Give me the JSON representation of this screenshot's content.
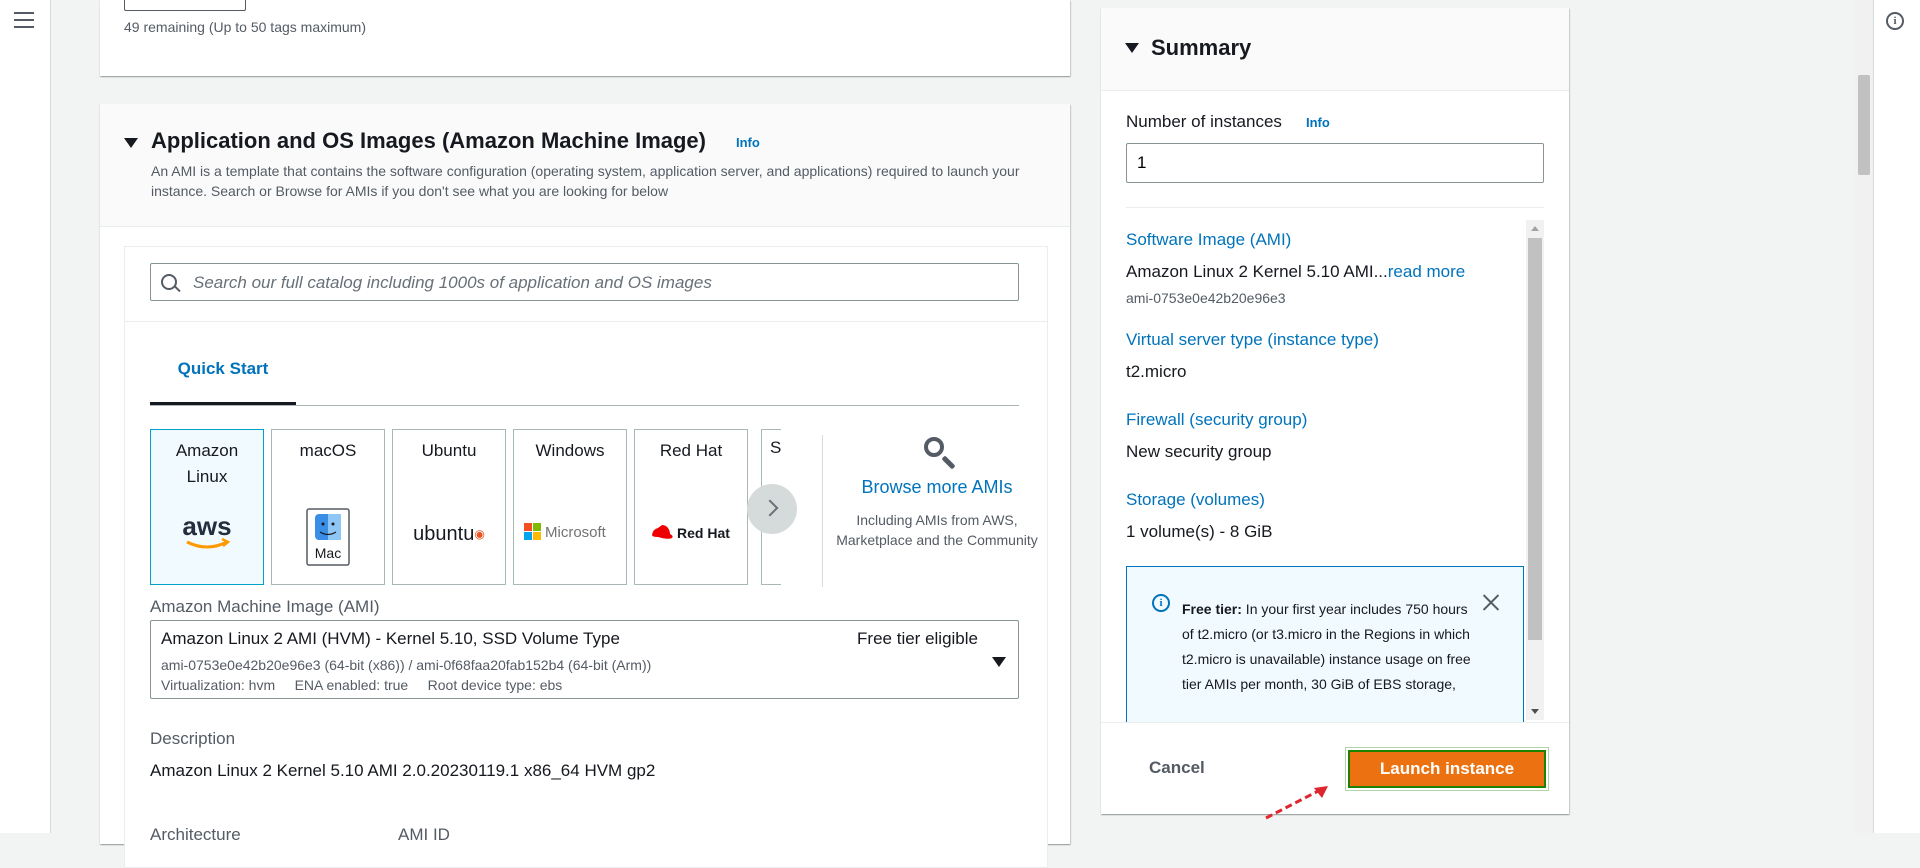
{
  "top": {
    "tags_remaining": "49 remaining (Up to 50 tags maximum)"
  },
  "ami_section": {
    "title": "Application and OS Images (Amazon Machine Image)",
    "info": "Info",
    "description": "An AMI is a template that contains the software configuration (operating system, application server, and applications) required to launch your instance. Search or Browse for AMIs if you don't see what you are looking for below",
    "search_placeholder": "Search our full catalog including 1000s of application and OS images",
    "tab": "Quick Start",
    "tiles": [
      {
        "label": "Amazon Linux",
        "logo": "aws"
      },
      {
        "label": "macOS",
        "logo": "Mac"
      },
      {
        "label": "Ubuntu",
        "logo": "ubuntu"
      },
      {
        "label": "Windows",
        "logo": "Microsoft"
      },
      {
        "label": "Red Hat",
        "logo": "Red Hat"
      },
      {
        "label": "S"
      }
    ],
    "browse": {
      "label": "Browse more AMIs",
      "sub": "Including AMIs from AWS, Marketplace and the Community"
    },
    "ami_label": "Amazon Machine Image (AMI)",
    "selected_ami": {
      "name": "Amazon Linux 2 AMI (HVM) - Kernel 5.10, SSD Volume Type",
      "badge": "Free tier eligible",
      "ids": "ami-0753e0e42b20e96e3 (64-bit (x86)) / ami-0f68faa20fab152b4 (64-bit (Arm))",
      "meta": "Virtualization: hvm     ENA enabled: true     Root device type: ebs"
    },
    "description_label": "Description",
    "description_value": "Amazon Linux 2 Kernel 5.10 AMI 2.0.20230119.1 x86_64 HVM gp2",
    "architecture_label": "Architecture",
    "ami_id_label": "AMI ID"
  },
  "summary": {
    "title": "Summary",
    "num_instances_label": "Number of instances",
    "info": "Info",
    "num_instances_value": "1",
    "software_image_label": "Software Image (AMI)",
    "software_image_value": "Amazon Linux 2 Kernel 5.10 AMI...",
    "read_more": "read more",
    "software_image_id": "ami-0753e0e42b20e96e3",
    "instance_type_label": "Virtual server type (instance type)",
    "instance_type_value": "t2.micro",
    "firewall_label": "Firewall (security group)",
    "firewall_value": "New security group",
    "storage_label": "Storage (volumes)",
    "storage_value": "1 volume(s) - 8 GiB",
    "free_tier_bold": "Free tier:",
    "free_tier_text": " In your first year includes 750 hours of t2.micro (or t3.micro in the Regions in which t2.micro is unavailable) instance usage on free tier AMIs per month, 30 GiB of EBS storage,",
    "cancel": "Cancel",
    "launch": "Launch instance"
  },
  "colors": {
    "accent": "#0073bb",
    "launch": "#ec7211",
    "arrow": "#e0262d"
  }
}
